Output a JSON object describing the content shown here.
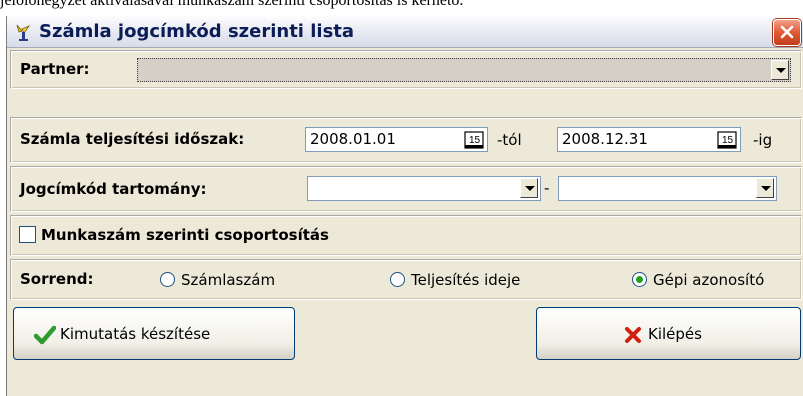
{
  "doc": {
    "top_line": "jelölőnégyzet aktiválásával munkaszám szerinti csoportosítás is kérhető."
  },
  "window": {
    "title": "Számla jogcímkód szerinti lista"
  },
  "partner": {
    "label": "Partner:",
    "value": ""
  },
  "period": {
    "label": "Számla teljesítési időszak:",
    "from_value": "2008.01.01",
    "from_suffix": "-tól",
    "to_value": "2008.12.31",
    "to_suffix": "-ig",
    "calendar_icon_text": "15"
  },
  "code_range": {
    "label": "Jogcímkód tartomány:",
    "from_value": "",
    "separator": "-",
    "to_value": ""
  },
  "grouping": {
    "label": "Munkaszám szerinti csoportosítás",
    "checked": false
  },
  "sort": {
    "label": "Sorrend:",
    "options": [
      {
        "label": "Számlaszám",
        "selected": false
      },
      {
        "label": "Teljesítés ideje",
        "selected": false
      },
      {
        "label": "Gépi azonosító",
        "selected": true
      }
    ]
  },
  "buttons": {
    "report_label": "Kimutatás készítése",
    "exit_label": "Kilépés"
  },
  "colors": {
    "title_text": "#0b1c57",
    "close_red": "#e05a36",
    "radio_selected": "#21a121",
    "panel_bg": "#ece9d8"
  },
  "icons": [
    "app-icon",
    "close-icon",
    "dropdown-arrow-icon",
    "calendar-icon",
    "checkmark-icon",
    "x-icon"
  ]
}
